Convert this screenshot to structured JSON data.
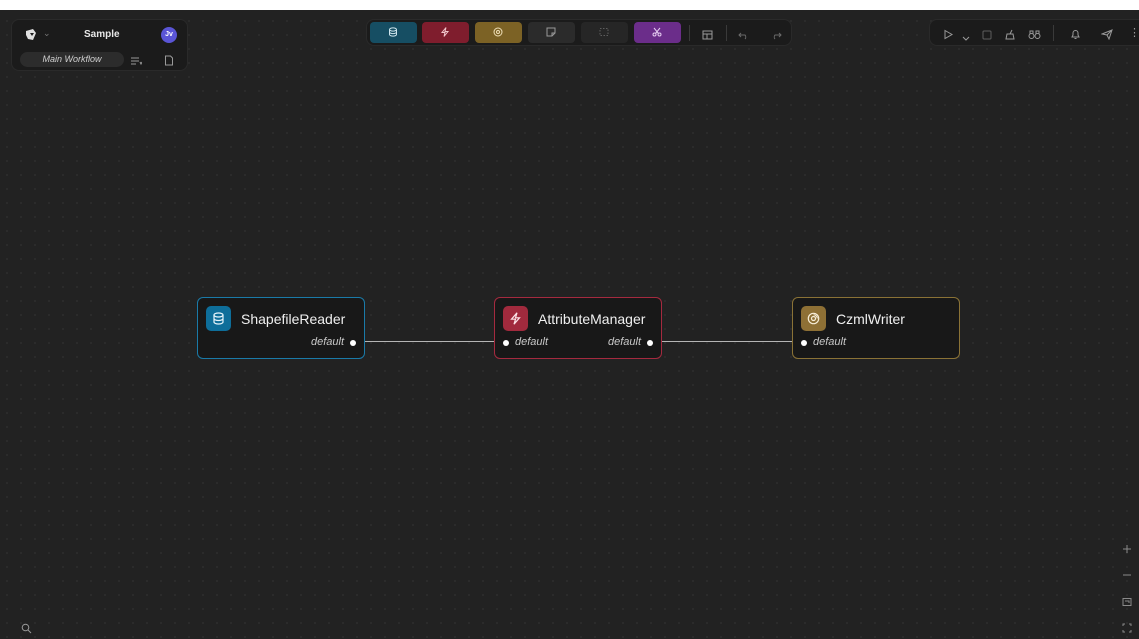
{
  "project": {
    "name": "Sample",
    "avatar_initials": "Jv",
    "avatar_color": "#5a55d6",
    "workflow_tab": "Main Workflow"
  },
  "toolbar": {
    "node_buttons": [
      {
        "name": "reader-button",
        "icon": "database-icon",
        "color": "#164e63"
      },
      {
        "name": "transformer-button",
        "icon": "lightning-icon",
        "color": "#7f1d2d"
      },
      {
        "name": "writer-button",
        "icon": "disc-icon",
        "color": "#7c6225"
      },
      {
        "name": "note-button",
        "icon": "note-icon",
        "color": "#2b2b2b"
      },
      {
        "name": "batch-button",
        "icon": "dashed-box-icon",
        "color": "#262626"
      },
      {
        "name": "subworkflow-button",
        "icon": "scissors-icon",
        "color": "#6b2d8a"
      }
    ],
    "extra": [
      "layout-icon",
      "undo-icon",
      "redo-icon"
    ]
  },
  "right_panel": [
    "play-icon",
    "chevron-down-icon",
    "stop-icon",
    "cleanup-icon",
    "binoculars-icon",
    "bell-icon",
    "send-icon",
    "more-icon"
  ],
  "nodes": [
    {
      "title": "ShapefileReader",
      "kind": "reader",
      "color": "#0e6e9a",
      "border": "#1a7aa8",
      "icon": "database-icon",
      "outputs": [
        "default"
      ]
    },
    {
      "title": "AttributeManager",
      "kind": "transformer",
      "color": "#a12a3d",
      "border": "#a52a3f",
      "icon": "lightning-icon",
      "inputs": [
        "default"
      ],
      "outputs": [
        "default"
      ]
    },
    {
      "title": "CzmlWriter",
      "kind": "writer",
      "color": "#8e7035",
      "border": "#8a7236",
      "icon": "disc-icon",
      "inputs": [
        "default"
      ]
    }
  ],
  "canvas_controls": [
    "zoom-in-icon",
    "zoom-out-icon",
    "fit-view-icon",
    "fullscreen-icon"
  ],
  "search": {
    "icon": "search-icon"
  }
}
